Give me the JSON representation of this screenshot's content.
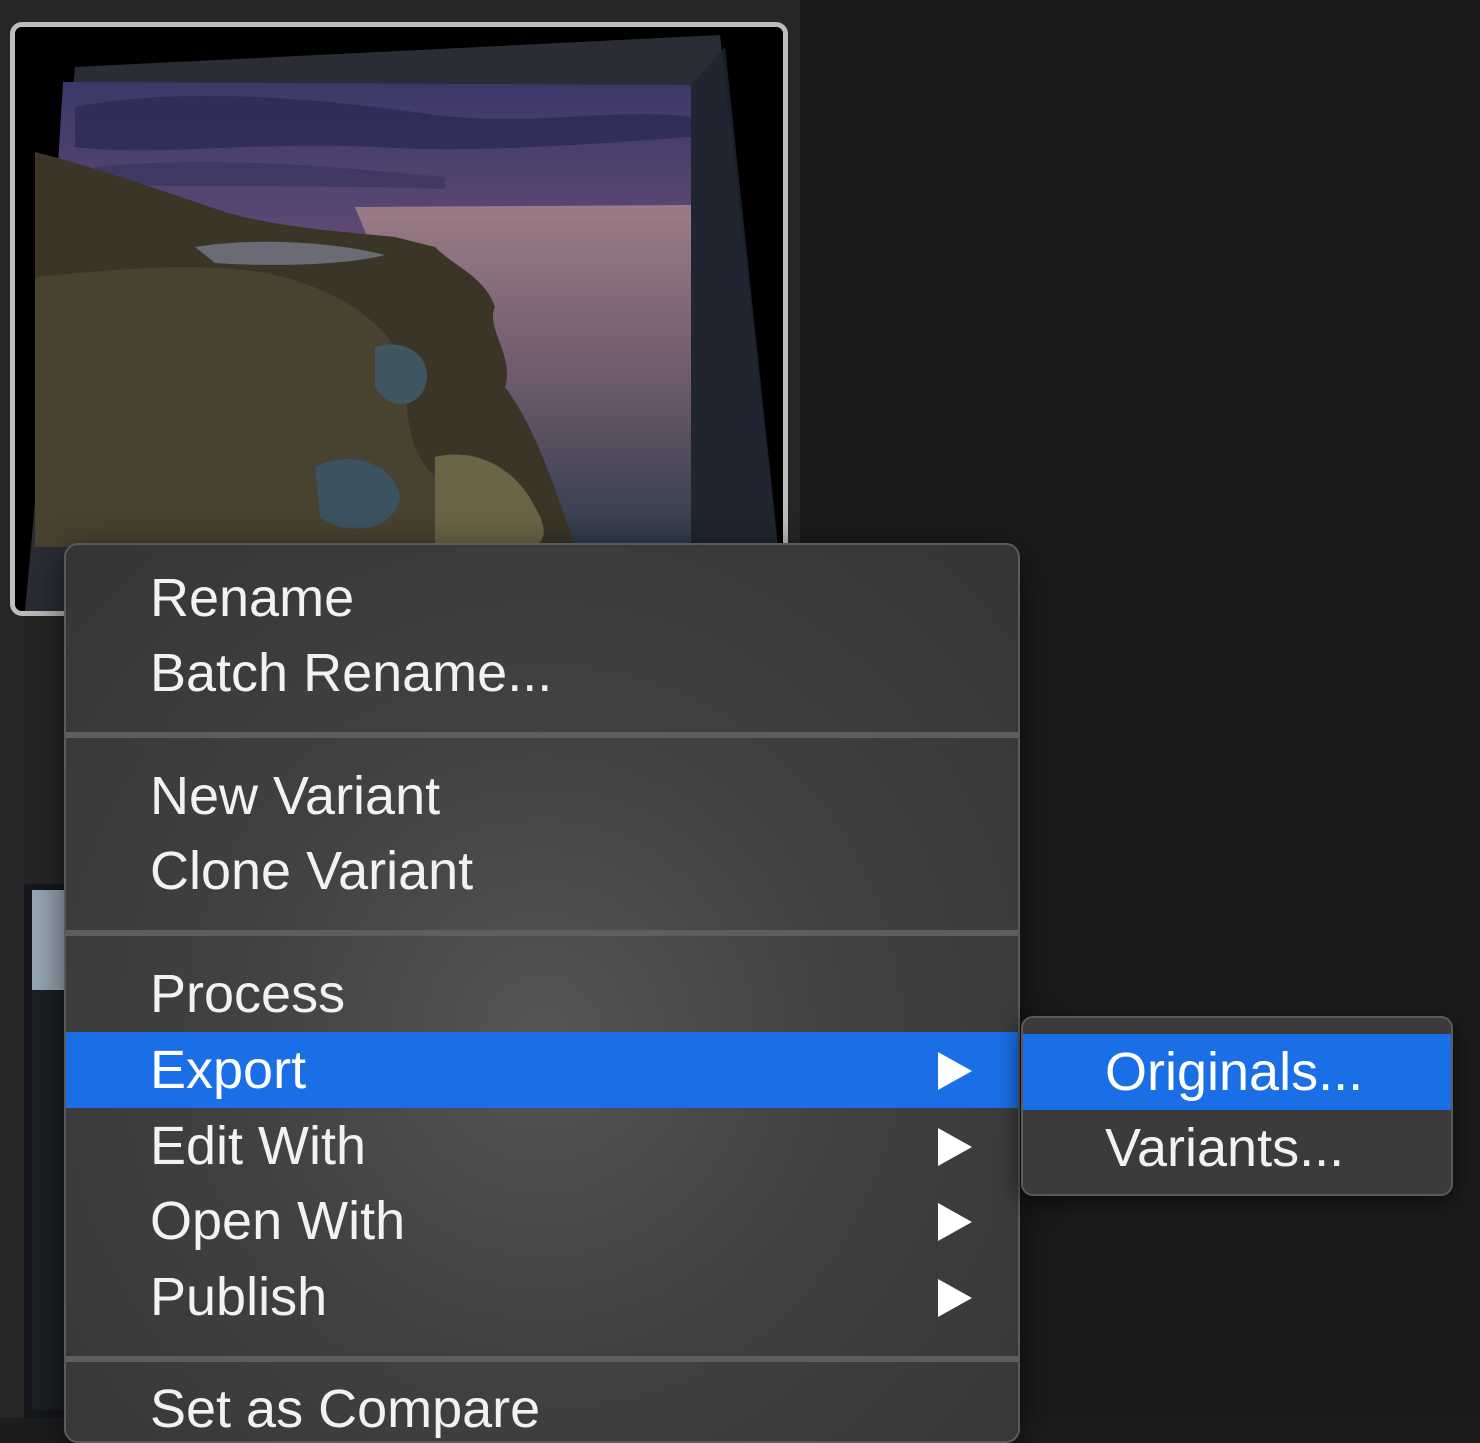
{
  "context_menu": {
    "groups": [
      {
        "items": [
          {
            "label": "Rename"
          },
          {
            "label": "Batch Rename..."
          }
        ]
      },
      {
        "items": [
          {
            "label": "New Variant"
          },
          {
            "label": "Clone Variant"
          }
        ]
      },
      {
        "items": [
          {
            "label": "Process"
          },
          {
            "label": "Export",
            "submenu": true,
            "highlighted": true
          },
          {
            "label": "Edit With",
            "submenu": true
          },
          {
            "label": "Open With",
            "submenu": true
          },
          {
            "label": "Publish",
            "submenu": true
          }
        ]
      },
      {
        "items": [
          {
            "label": "Set as Compare"
          }
        ]
      }
    ]
  },
  "export_submenu": {
    "items": [
      {
        "label": "Originals...",
        "highlighted": true
      },
      {
        "label": "Variants..."
      }
    ]
  },
  "colors": {
    "highlight": "#1a6ee6",
    "menu_text": "#f2f2f2",
    "thumb_border": "#bdbdbd"
  },
  "icons": {
    "submenu_indicator": "triangle-right-icon"
  }
}
